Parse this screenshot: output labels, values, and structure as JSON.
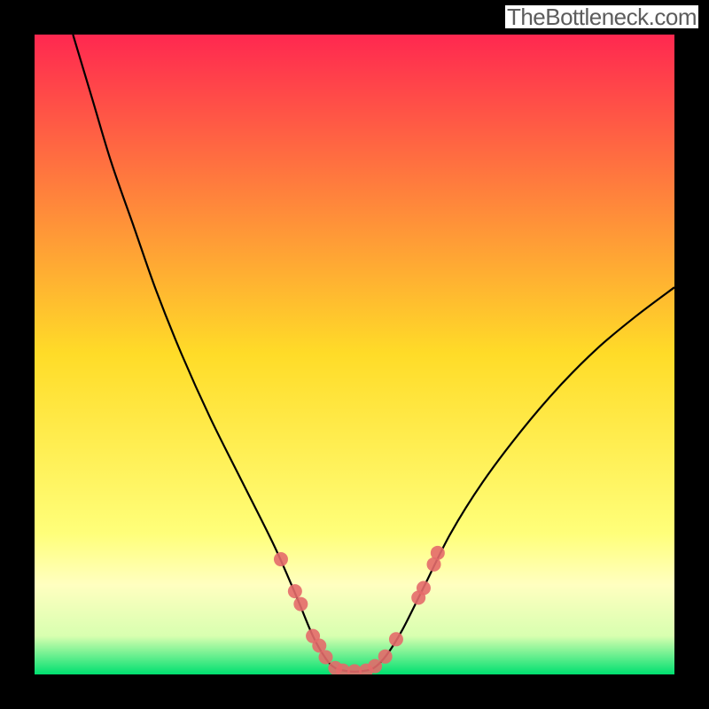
{
  "watermark": "TheBottleneck.com",
  "chart_data": {
    "type": "line",
    "title": "",
    "xlabel": "",
    "ylabel": "",
    "xlim": [
      0,
      100
    ],
    "ylim": [
      0,
      100
    ],
    "background_gradient": {
      "stops": [
        {
          "offset": 0.0,
          "color": "#ff2850"
        },
        {
          "offset": 0.5,
          "color": "#ffdc28"
        },
        {
          "offset": 0.78,
          "color": "#ffff7a"
        },
        {
          "offset": 0.86,
          "color": "#ffffc0"
        },
        {
          "offset": 0.94,
          "color": "#d8ffb0"
        },
        {
          "offset": 1.0,
          "color": "#00e070"
        }
      ]
    },
    "series": [
      {
        "name": "curve",
        "color": "#000000",
        "data": [
          {
            "x": 6.0,
            "y": 100.0
          },
          {
            "x": 9.0,
            "y": 90.0
          },
          {
            "x": 12.0,
            "y": 80.0
          },
          {
            "x": 15.5,
            "y": 70.0
          },
          {
            "x": 19.0,
            "y": 60.0
          },
          {
            "x": 23.0,
            "y": 50.0
          },
          {
            "x": 27.5,
            "y": 40.0
          },
          {
            "x": 32.5,
            "y": 30.0
          },
          {
            "x": 37.5,
            "y": 20.0
          },
          {
            "x": 41.0,
            "y": 12.0
          },
          {
            "x": 43.5,
            "y": 6.0
          },
          {
            "x": 45.5,
            "y": 2.5
          },
          {
            "x": 47.0,
            "y": 1.0
          },
          {
            "x": 49.0,
            "y": 0.5
          },
          {
            "x": 51.0,
            "y": 0.5
          },
          {
            "x": 53.0,
            "y": 1.0
          },
          {
            "x": 55.0,
            "y": 3.0
          },
          {
            "x": 57.5,
            "y": 7.0
          },
          {
            "x": 61.0,
            "y": 14.0
          },
          {
            "x": 65.0,
            "y": 22.0
          },
          {
            "x": 70.0,
            "y": 30.0
          },
          {
            "x": 76.0,
            "y": 38.0
          },
          {
            "x": 82.0,
            "y": 45.0
          },
          {
            "x": 88.0,
            "y": 51.0
          },
          {
            "x": 94.0,
            "y": 56.0
          },
          {
            "x": 100.0,
            "y": 60.5
          }
        ]
      }
    ],
    "markers": {
      "name": "threshold-dots",
      "color": "#e46a6a",
      "radius_px": 8,
      "data": [
        {
          "x": 38.5,
          "y": 18.0
        },
        {
          "x": 40.7,
          "y": 13.0
        },
        {
          "x": 41.6,
          "y": 11.0
        },
        {
          "x": 43.5,
          "y": 6.0
        },
        {
          "x": 44.5,
          "y": 4.5
        },
        {
          "x": 45.5,
          "y": 2.7
        },
        {
          "x": 47.0,
          "y": 1.0
        },
        {
          "x": 48.2,
          "y": 0.6
        },
        {
          "x": 50.0,
          "y": 0.5
        },
        {
          "x": 51.8,
          "y": 0.6
        },
        {
          "x": 53.2,
          "y": 1.3
        },
        {
          "x": 54.8,
          "y": 2.8
        },
        {
          "x": 56.5,
          "y": 5.5
        },
        {
          "x": 60.0,
          "y": 12.0
        },
        {
          "x": 60.8,
          "y": 13.5
        },
        {
          "x": 62.4,
          "y": 17.2
        },
        {
          "x": 63.0,
          "y": 19.0
        }
      ]
    }
  }
}
